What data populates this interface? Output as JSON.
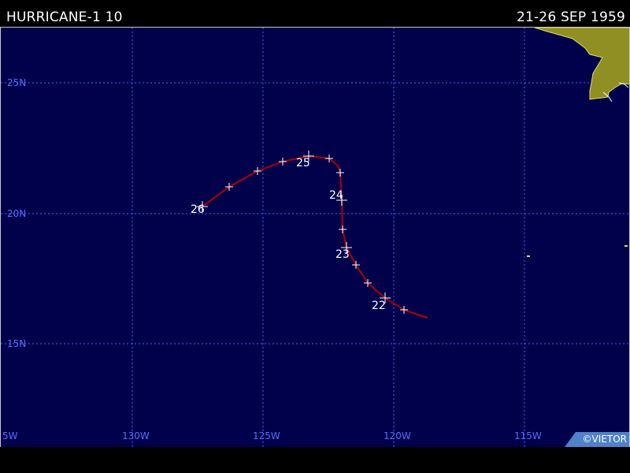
{
  "header": {
    "title": "HURRICANE-1 10",
    "date_range": "21-26 SEP 1959"
  },
  "map": {
    "colors": {
      "ocean": "#00004b",
      "grid": "#4d63ff",
      "track": "#b00000",
      "land": "#8f8f24",
      "labels": "#5a6cff",
      "markers": "#ffffff"
    },
    "latitude_labels": [
      "25N",
      "20N",
      "15N"
    ],
    "longitude_labels": [
      "5W",
      "130W",
      "125W",
      "120W",
      "115W"
    ],
    "day_labels": [
      "22",
      "23",
      "24",
      "25",
      "26"
    ],
    "copyright": "©VIETOR"
  }
}
